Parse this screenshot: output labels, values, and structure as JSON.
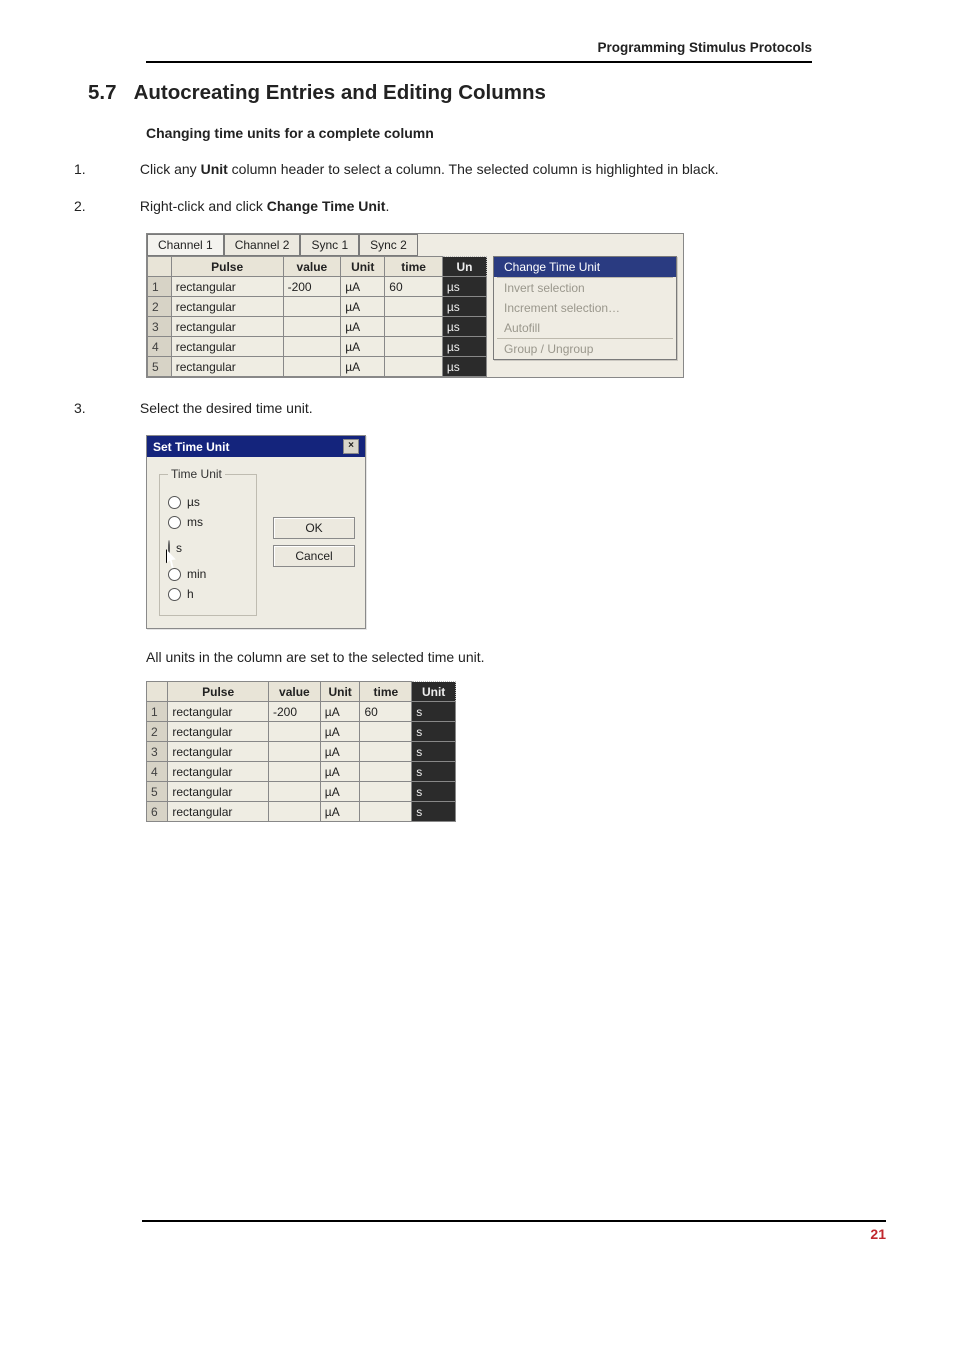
{
  "header": "Programming Stimulus Protocols",
  "section_number": "5.7",
  "section_title": "Autocreating Entries and Editing Columns",
  "sub_title": "Changing time units for a complete column",
  "steps": [
    {
      "num": "1.",
      "pre": "Click any ",
      "b1": "Unit",
      "post": " column header to select a column. The selected column is highlighted in black."
    },
    {
      "num": "2.",
      "pre": "Right-click and click ",
      "b1": "Change Time Unit",
      "post": "."
    },
    {
      "num": "3.",
      "pre": "Select the desired time unit.",
      "b1": "",
      "post": ""
    }
  ],
  "tabs": [
    "Channel 1",
    "Channel 2",
    "Sync 1",
    "Sync 2"
  ],
  "grid_headers": {
    "pulse": "Pulse",
    "value": "value",
    "unit": "Unit",
    "time": "time",
    "un2": "Un"
  },
  "grid1_rows": [
    {
      "n": "1",
      "pulse": "rectangular",
      "value": "-200",
      "unit": "µA",
      "time": "60",
      "u2": "µs"
    },
    {
      "n": "2",
      "pulse": "rectangular",
      "value": "",
      "unit": "µA",
      "time": "",
      "u2": "µs"
    },
    {
      "n": "3",
      "pulse": "rectangular",
      "value": "",
      "unit": "µA",
      "time": "",
      "u2": "µs"
    },
    {
      "n": "4",
      "pulse": "rectangular",
      "value": "",
      "unit": "µA",
      "time": "",
      "u2": "µs"
    },
    {
      "n": "5",
      "pulse": "rectangular",
      "value": "",
      "unit": "µA",
      "time": "",
      "u2": "µs"
    }
  ],
  "context_menu": {
    "items": [
      {
        "label": "Change Time Unit",
        "active": true
      },
      {
        "label": "Invert selection",
        "active": false
      },
      {
        "label": "Increment selection…",
        "active": false
      },
      {
        "label": "Autofill",
        "active": false
      },
      {
        "label": "Group / Ungroup",
        "active": false
      }
    ]
  },
  "dialog": {
    "title": "Set Time Unit",
    "legend": "Time Unit",
    "options": [
      "µs",
      "ms",
      "s",
      "min",
      "h"
    ],
    "selected": "s",
    "ok": "OK",
    "cancel": "Cancel"
  },
  "after_dialog": "All units in the column are set to the selected time unit.",
  "grid2_rows": [
    {
      "n": "1",
      "pulse": "rectangular",
      "value": "-200",
      "unit": "µA",
      "time": "60",
      "u2": "s"
    },
    {
      "n": "2",
      "pulse": "rectangular",
      "value": "",
      "unit": "µA",
      "time": "",
      "u2": "s"
    },
    {
      "n": "3",
      "pulse": "rectangular",
      "value": "",
      "unit": "µA",
      "time": "",
      "u2": "s"
    },
    {
      "n": "4",
      "pulse": "rectangular",
      "value": "",
      "unit": "µA",
      "time": "",
      "u2": "s"
    },
    {
      "n": "5",
      "pulse": "rectangular",
      "value": "",
      "unit": "µA",
      "time": "",
      "u2": "s"
    },
    {
      "n": "6",
      "pulse": "rectangular",
      "value": "",
      "unit": "µA",
      "time": "",
      "u2": "s"
    }
  ],
  "page_number": "21"
}
